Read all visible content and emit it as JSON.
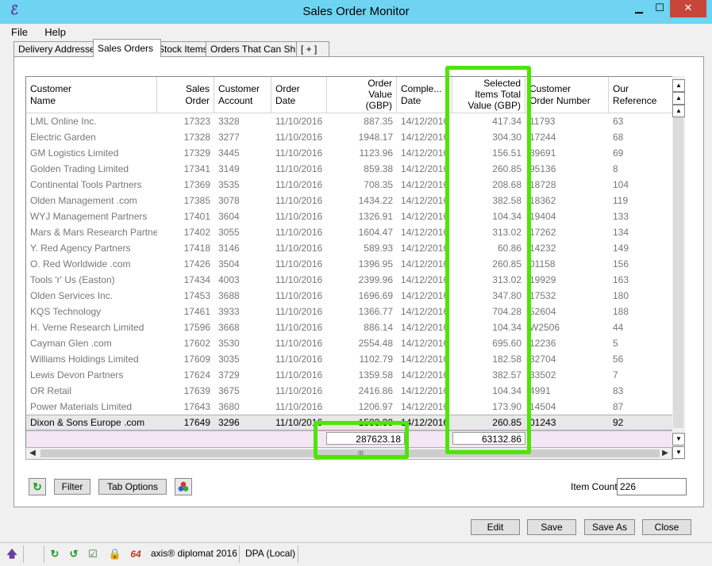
{
  "window": {
    "title": "Sales Order Monitor",
    "minimize": "▁",
    "maximize": "☐",
    "close": "✕"
  },
  "menu": [
    "File",
    "Help"
  ],
  "tabs": [
    "Delivery Addresses",
    "Sales Orders",
    "Stock Items",
    "Orders That Can Ship",
    "[ + ]"
  ],
  "active_tab": "Sales Orders",
  "columns": [
    {
      "key": "name",
      "label": "Customer\nName"
    },
    {
      "key": "order",
      "label": "Sales\nOrder"
    },
    {
      "key": "account",
      "label": "Customer\nAccount"
    },
    {
      "key": "date",
      "label": "Order\nDate"
    },
    {
      "key": "value",
      "label": "Order\nValue\n(GBP)"
    },
    {
      "key": "comp",
      "label": "Comple...\nDate"
    },
    {
      "key": "sel",
      "label": "Selected\nItems Total\nValue (GBP)"
    },
    {
      "key": "cust_order",
      "label": "Customer\nOrder Number"
    },
    {
      "key": "ref",
      "label": "Our\nReference"
    }
  ],
  "rows": [
    [
      "LML Online Inc.",
      "17323",
      "3328",
      "11/10/2016",
      "887.35",
      "14/12/2016",
      "417.34",
      "11793",
      "63"
    ],
    [
      "Electric Garden",
      "17328",
      "3277",
      "11/10/2016",
      "1948.17",
      "14/12/2016",
      "304.30",
      "17244",
      "68"
    ],
    [
      "GM Logistics Limited",
      "17329",
      "3445",
      "11/10/2016",
      "1123.96",
      "14/12/2016",
      "156.51",
      "39691",
      "69"
    ],
    [
      "Golden Trading Limited",
      "17341",
      "3149",
      "11/10/2016",
      "859.38",
      "14/12/2016",
      "260.85",
      "95136",
      "8"
    ],
    [
      "Continental Tools Partners",
      "17369",
      "3535",
      "11/10/2016",
      "708.35",
      "14/12/2016",
      "208.68",
      "18728",
      "104"
    ],
    [
      "Olden Management .com",
      "17385",
      "3078",
      "11/10/2016",
      "1434.22",
      "14/12/2016",
      "382.58",
      "18362",
      "119"
    ],
    [
      "WYJ Management Partners",
      "17401",
      "3604",
      "11/10/2016",
      "1326.91",
      "14/12/2016",
      "104.34",
      "19404",
      "133"
    ],
    [
      "Mars & Mars Research Partners",
      "17402",
      "3055",
      "11/10/2016",
      "1604.47",
      "14/12/2016",
      "313.02",
      "17262",
      "134"
    ],
    [
      "Y. Red Agency Partners",
      "17418",
      "3146",
      "11/10/2016",
      "589.93",
      "14/12/2016",
      "60.86",
      "14232",
      "149"
    ],
    [
      "O. Red Worldwide .com",
      "17426",
      "3504",
      "11/10/2016",
      "1396.95",
      "14/12/2016",
      "260.85",
      "01158",
      "156"
    ],
    [
      "Tools 'r' Us (Easton)",
      "17434",
      "4003",
      "11/10/2016",
      "2399.96",
      "14/12/2016",
      "313.02",
      "19929",
      "163"
    ],
    [
      "Olden Services Inc.",
      "17453",
      "3688",
      "11/10/2016",
      "1696.69",
      "14/12/2016",
      "347.80",
      "17532",
      "180"
    ],
    [
      "KQS Technology",
      "17461",
      "3933",
      "11/10/2016",
      "1366.77",
      "14/12/2016",
      "704.28",
      "52604",
      "188"
    ],
    [
      "H. Verne Research Limited",
      "17596",
      "3668",
      "11/10/2016",
      "886.14",
      "14/12/2016",
      "104.34",
      "W2506",
      "44"
    ],
    [
      "Cayman Glen .com",
      "17602",
      "3530",
      "11/10/2016",
      "2554.48",
      "14/12/2016",
      "695.60",
      "12236",
      "5"
    ],
    [
      "Williams Holdings Limited",
      "17609",
      "3035",
      "11/10/2016",
      "1102.79",
      "14/12/2016",
      "182.58",
      "32704",
      "56"
    ],
    [
      "Lewis Devon Partners",
      "17624",
      "3729",
      "11/10/2016",
      "1359.58",
      "14/12/2016",
      "382.57",
      "33502",
      "7"
    ],
    [
      "OR Retail",
      "17639",
      "3675",
      "11/10/2016",
      "2416.86",
      "14/12/2016",
      "104.34",
      "4991",
      "83"
    ],
    [
      "Power Materials Limited",
      "17643",
      "3680",
      "11/10/2016",
      "1206.97",
      "14/12/2016",
      "173.90",
      "14504",
      "87"
    ],
    [
      "Dixon & Sons Europe .com",
      "17649",
      "3296",
      "11/10/2016",
      "1583.30",
      "14/12/2016",
      "260.85",
      "01243",
      "92"
    ]
  ],
  "totals": {
    "value": "287623.18",
    "sel": "63132.86"
  },
  "toolbar": {
    "refresh_icon": "↻",
    "filter": "Filter",
    "tab_options": "Tab Options",
    "colors_icon": "●"
  },
  "item_count": {
    "label": "Item Count",
    "value": "226"
  },
  "actions": {
    "edit": "Edit",
    "save": "Save",
    "save_as": "Save As",
    "close": "Close"
  },
  "statusbar": {
    "app": "axis® diplomat 2016",
    "db": "DPA (Local)",
    "badge": "64"
  },
  "colors": {
    "highlight": "#4ce600",
    "titlebar": "#6fd3f2",
    "close": "#c7463a",
    "totals_bg": "#f4e6f4"
  }
}
